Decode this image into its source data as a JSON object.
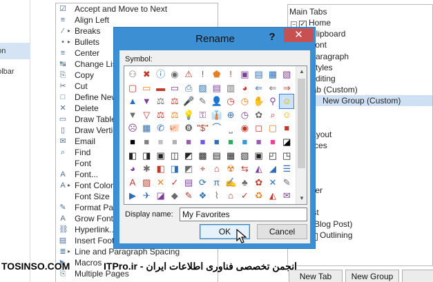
{
  "left_panel": {
    "items": [
      "oon",
      "oolbar"
    ]
  },
  "commands": [
    {
      "icon": "☑",
      "label": "Accept and Move to Next",
      "arrow": false
    },
    {
      "icon": "≡",
      "label": "Align Left",
      "arrow": false
    },
    {
      "icon": "⁄",
      "label": "Breaks",
      "arrow": true
    },
    {
      "icon": "•",
      "label": "Bullets",
      "arrow": true
    },
    {
      "icon": "≡",
      "label": "Center",
      "arrow": false
    },
    {
      "icon": "↹",
      "label": "Change Lis",
      "arrow": false
    },
    {
      "icon": "⎘",
      "label": "Copy",
      "arrow": false
    },
    {
      "icon": "✂",
      "label": "Cut",
      "arrow": false
    },
    {
      "icon": "□",
      "label": "Define New",
      "arrow": false
    },
    {
      "icon": "✕",
      "label": "Delete",
      "arrow": false
    },
    {
      "icon": "▭",
      "label": "Draw Table",
      "arrow": false
    },
    {
      "icon": "▯",
      "label": "Draw Vertic",
      "arrow": false
    },
    {
      "icon": "✉",
      "label": "Email",
      "arrow": false
    },
    {
      "icon": "⌕",
      "label": "Find",
      "arrow": false
    },
    {
      "icon": "",
      "label": "Font",
      "arrow": false
    },
    {
      "icon": "A",
      "label": "Font...",
      "arrow": false
    },
    {
      "icon": "A",
      "label": "Font Color",
      "arrow": true
    },
    {
      "icon": "",
      "label": "Font Size",
      "arrow": false
    },
    {
      "icon": "✎",
      "label": "Format Pai",
      "arrow": false
    },
    {
      "icon": "A",
      "label": "Grow Font",
      "arrow": false
    },
    {
      "icon": "⛓",
      "label": "Hyperlink...",
      "arrow": false
    },
    {
      "icon": "▤",
      "label": "Insert Foot",
      "arrow": false
    },
    {
      "icon": "≣",
      "label": "Line and Paragraph Spacing",
      "arrow": true
    },
    {
      "icon": "▶",
      "label": "Macros",
      "arrow": false
    },
    {
      "icon": "⎘",
      "label": "Multiple Pages",
      "arrow": false
    }
  ],
  "tree": {
    "header": "Main Tabs",
    "rows": [
      {
        "indent": 4,
        "exp": "−",
        "chk": true,
        "label": "Home",
        "sel": false
      },
      {
        "indent": 20,
        "exp": "+",
        "chk": false,
        "label": "Clipboard",
        "sel": false
      },
      {
        "indent": 20,
        "exp": "+",
        "chk": false,
        "label": "Font",
        "sel": false
      },
      {
        "indent": 20,
        "exp": "+",
        "chk": false,
        "label": "Paragraph",
        "sel": false
      },
      {
        "indent": 20,
        "exp": "+",
        "chk": false,
        "label": "Styles",
        "sel": false
      },
      {
        "indent": 20,
        "exp": "+",
        "chk": false,
        "label": "Editing",
        "sel": false
      },
      {
        "indent": 4,
        "exp": "",
        "chk": false,
        "label": "ori's Tab (Custom)",
        "sel": false
      },
      {
        "indent": 4,
        "exp": "",
        "chk": false,
        "label": "New Group (Custom)",
        "sel": true
      },
      {
        "indent": 4,
        "exp": "",
        "chk": false,
        "label": "sert",
        "sel": false
      },
      {
        "indent": 4,
        "exp": "",
        "chk": false,
        "label": "esign",
        "sel": false
      },
      {
        "indent": 4,
        "exp": "",
        "chk": false,
        "label": "age Layout",
        "sel": false
      },
      {
        "indent": 4,
        "exp": "",
        "chk": false,
        "label": "eferences",
        "sel": false
      },
      {
        "indent": 4,
        "exp": "",
        "chk": false,
        "label": "ailings",
        "sel": false
      },
      {
        "indent": 4,
        "exp": "",
        "chk": false,
        "label": "eview",
        "sel": false
      },
      {
        "indent": 4,
        "exp": "",
        "chk": false,
        "label": "iew",
        "sel": false
      },
      {
        "indent": 4,
        "exp": "",
        "chk": false,
        "label": "eveloper",
        "sel": false
      },
      {
        "indent": 4,
        "exp": "",
        "chk": false,
        "label": "dd-Ins",
        "sel": false
      },
      {
        "indent": 4,
        "exp": "",
        "chk": false,
        "label": "og Post",
        "sel": false
      },
      {
        "indent": 4,
        "exp": "",
        "chk": false,
        "label": "nsert (Blog Post)",
        "sel": false
      },
      {
        "indent": 20,
        "exp": "+",
        "chk": true,
        "label": "Outlining",
        "sel": false
      }
    ]
  },
  "bottom_buttons": {
    "new_tab": "New Tab",
    "new_group": "New Group"
  },
  "watermark": {
    "left": "TOSINSO.COM",
    "right": "ITPro.ir - انجمن تخصصی فناوری اطلاعات ایران"
  },
  "dialog": {
    "title": "Rename",
    "help": "?",
    "close": "✕",
    "symbol_label": "Symbol:",
    "display_name_label": "Display name:",
    "display_name_value": "My Favorites",
    "ok_label": "OK",
    "cancel_label": "Cancel",
    "symbols": [
      [
        "⚇",
        "✖",
        "ⓘ",
        "◉",
        "⚠",
        "!",
        "⬟",
        "!",
        "▣",
        "▤",
        "▦",
        "▧"
      ],
      [
        "▢",
        "▭",
        "▬",
        "▭",
        "⎙",
        "▨",
        "▤",
        "▥",
        "◕",
        "⇐",
        "⇐",
        "⇒"
      ],
      [
        "▲",
        "▼",
        "⚖",
        "⚖",
        "🎤",
        "✎",
        "👤",
        "◷",
        "◷",
        "✋",
        "⚲",
        "☺"
      ],
      [
        "▼",
        "▽",
        "⚖",
        "⚖",
        "💡",
        "⚿",
        "👔",
        "⊕",
        "◷",
        "✿",
        "⌕",
        "☺"
      ],
      [
        "☹",
        "▦",
        "✆",
        "🐖",
        "❽",
        "\"$\"",
        "⌒",
        "⎵",
        "◉",
        "◻",
        "▢",
        "■"
      ],
      [
        "■",
        "■",
        "■",
        "■",
        "■",
        "■",
        "■",
        "■",
        "■",
        "■",
        "■",
        "◪"
      ],
      [
        "◧",
        "◨",
        "▣",
        "◫",
        "◩",
        "▩",
        "▤",
        "▦",
        "▧",
        "▣",
        "◰",
        "◳"
      ],
      [
        "◕",
        "✱",
        "◧",
        "◨",
        "◩",
        "⌖",
        "⌂",
        "☢",
        "⇆",
        "◭",
        "◢",
        "☰"
      ],
      [
        "Α",
        "▨",
        "✕",
        "✓",
        "▤",
        "⟳",
        "π",
        "✍",
        "♣",
        "✿",
        "✕",
        "✎"
      ],
      [
        "▶",
        "✈",
        "◪",
        "◆",
        "✎",
        "❖",
        "⌇",
        "⌂",
        "✓",
        "♻",
        "◭",
        "✉"
      ]
    ],
    "colors": {
      "title_bar": "#3d8fd4",
      "close_button": "#c75050",
      "selected_cell": "#cde3fb",
      "selected_tree_row": "#cfe0f4"
    }
  }
}
